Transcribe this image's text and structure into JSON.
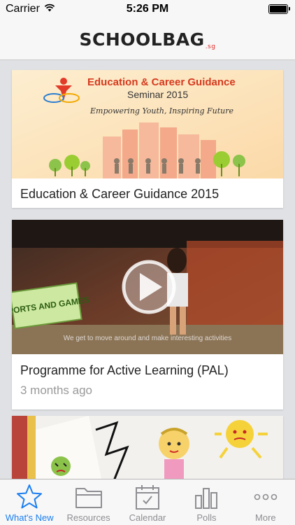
{
  "status_bar": {
    "carrier": "Carrier",
    "time": "5:26 PM",
    "battery_level": 1.0
  },
  "header": {
    "logo_school": "SCHOOL",
    "logo_bag": "BAG",
    "logo_sg": ".sg"
  },
  "feed": {
    "cards": [
      {
        "title": "Education & Career Guidance 2015",
        "banner": {
          "heading": "Education & Career Guidance",
          "subheading": "Seminar 2015",
          "tagline": "Empowering Youth, Inspiring Future"
        }
      },
      {
        "title": "Programme for Active Learning (PAL)",
        "meta": "3 months ago",
        "video": {
          "sign_text": "SPORTS AND GAMES",
          "caption": "We get to move around and make interesting activities"
        }
      },
      {
        "title": ""
      }
    ]
  },
  "tab_bar": {
    "tabs": [
      {
        "label": "What's New",
        "icon": "star-icon",
        "active": true
      },
      {
        "label": "Resources",
        "icon": "folder-icon",
        "active": false
      },
      {
        "label": "Calendar",
        "icon": "calendar-icon",
        "active": false
      },
      {
        "label": "Polls",
        "icon": "bar-chart-icon",
        "active": false
      },
      {
        "label": "More",
        "icon": "more-icon",
        "active": false
      }
    ]
  },
  "colors": {
    "accent": "#1a7ef0",
    "inactive": "#8e8e93",
    "background": "#dfe1e4"
  }
}
